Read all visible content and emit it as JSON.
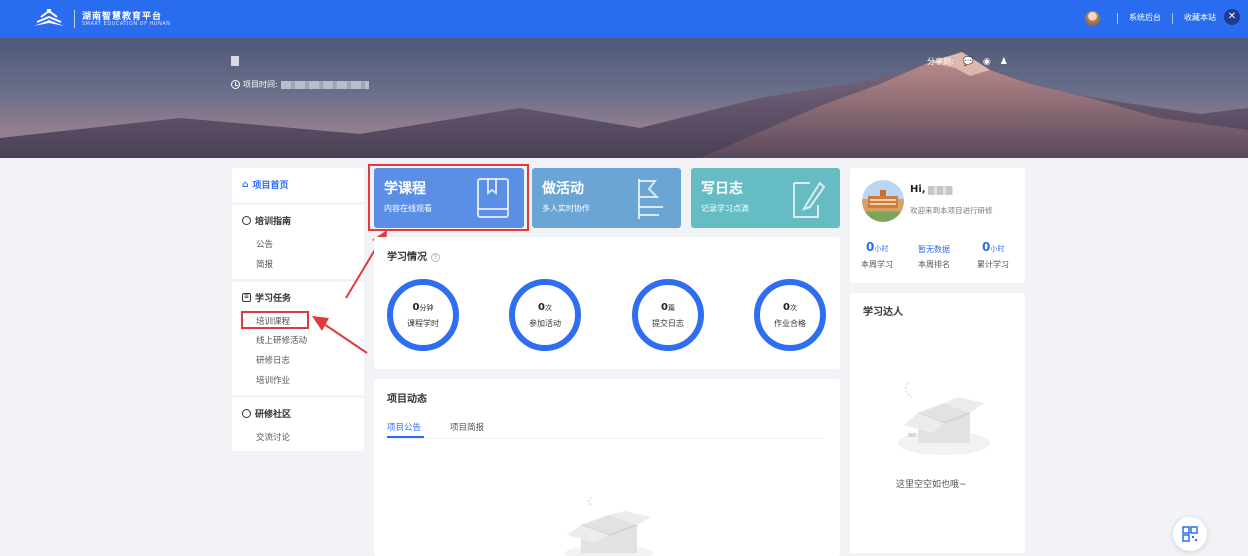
{
  "header": {
    "brand_cn": "湖南智慧教育平台",
    "brand_en": "SMART EDUCATION OF HUNAN",
    "links": [
      "系统后台",
      "收藏本站"
    ],
    "close_glyph": "✕"
  },
  "banner": {
    "time_label": "项目时间:",
    "share_label": "分享到:",
    "share_icons": [
      "wechat-icon",
      "weibo-icon",
      "qq-icon"
    ]
  },
  "sidebar": {
    "home": "项目首页",
    "sections": [
      {
        "title": "培训指南",
        "items": [
          "公告",
          "简报"
        ]
      },
      {
        "title": "学习任务",
        "items": [
          "培训课程",
          "线上研修活动",
          "研修日志",
          "培训作业"
        ]
      },
      {
        "title": "研修社区",
        "items": [
          "交流讨论"
        ]
      }
    ]
  },
  "cards": [
    {
      "title": "学课程",
      "subtitle": "内容在线观看",
      "icon": "book-icon",
      "color": "#5b8fe6"
    },
    {
      "title": "做活动",
      "subtitle": "多人实时协作",
      "icon": "flag-icon",
      "color": "#6aa5d6"
    },
    {
      "title": "写日志",
      "subtitle": "记录学习点滴",
      "icon": "edit-icon",
      "color": "#66bcc3"
    }
  ],
  "learning": {
    "title": "学习情况",
    "stats": [
      {
        "value": "0",
        "unit": "分钟",
        "label": "课程学时"
      },
      {
        "value": "0",
        "unit": "次",
        "label": "参加活动"
      },
      {
        "value": "0",
        "unit": "篇",
        "label": "提交日志"
      },
      {
        "value": "0",
        "unit": "次",
        "label": "作业合格"
      }
    ]
  },
  "dynamics": {
    "title": "项目动态",
    "tabs": [
      "项目公告",
      "项目简报"
    ]
  },
  "profile": {
    "greeting": "Hi,",
    "welcome": "欢迎来到本项目进行研修",
    "stats": [
      {
        "value": "0",
        "unit": "小时",
        "label": "本周学习"
      },
      {
        "value": "暂无数据",
        "unit": "",
        "label": "本周排名"
      },
      {
        "value": "0",
        "unit": "小时",
        "label": "累计学习"
      }
    ]
  },
  "experts": {
    "title": "学习达人",
    "empty": "这里空空如也哦~"
  },
  "colors": {
    "primary": "#2a6cf0",
    "highlight": "#e0393e"
  }
}
